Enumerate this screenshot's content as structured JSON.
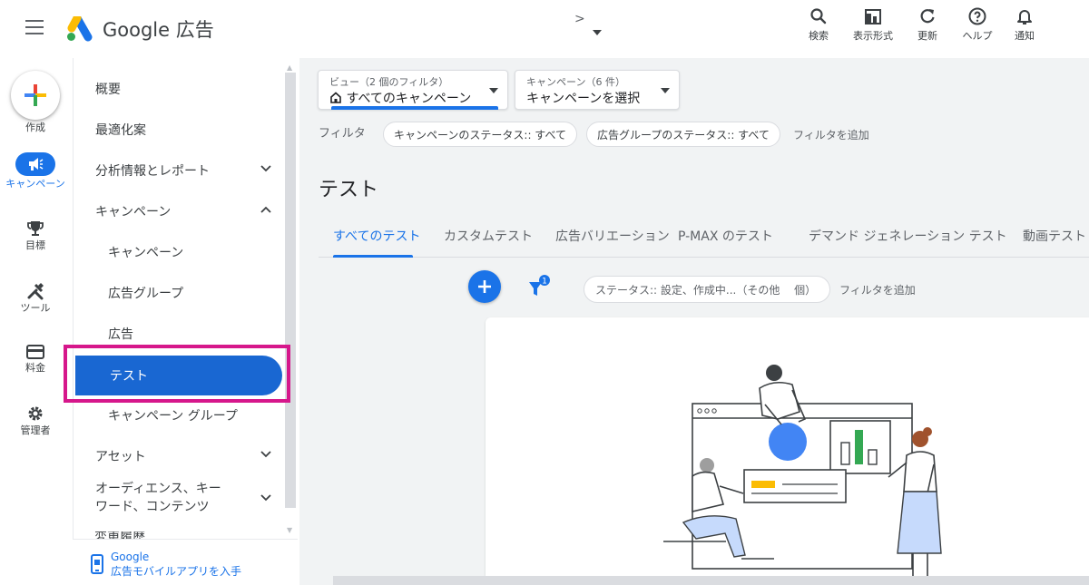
{
  "header": {
    "brand": "Google 広告",
    "breadcrumb_arrow": ">",
    "tools": [
      {
        "icon": "search-icon",
        "label": "検索"
      },
      {
        "icon": "view-format-icon",
        "label": "表示形式"
      },
      {
        "icon": "refresh-icon",
        "label": "更新"
      },
      {
        "icon": "help-icon",
        "label": "ヘルプ"
      },
      {
        "icon": "bell-icon",
        "label": "通知"
      }
    ]
  },
  "rail": {
    "create_label": "作成",
    "items": [
      {
        "icon": "megaphone-icon",
        "label": "キャンペーン",
        "active": true
      },
      {
        "icon": "trophy-icon",
        "label": "目標"
      },
      {
        "icon": "tools-icon",
        "label": "ツール"
      },
      {
        "icon": "credit-card-icon",
        "label": "料金"
      },
      {
        "icon": "gear-icon",
        "label": "管理者"
      }
    ]
  },
  "subnav": {
    "items": [
      {
        "label": "概要"
      },
      {
        "label": "最適化案"
      },
      {
        "label": "分析情報とレポート"
      },
      {
        "label": "キャンペーン"
      },
      {
        "label": "キャンペーン"
      },
      {
        "label": "広告グループ"
      },
      {
        "label": "広告"
      },
      {
        "label": "テスト"
      },
      {
        "label": "キャンペーン グループ"
      },
      {
        "label": "アセット"
      },
      {
        "label": "オーディエンス、キーワード、コンテンツ"
      },
      {
        "label": "変更履歴"
      }
    ],
    "app_promo": {
      "line1": "Google",
      "line2": "広告モバイルアプリを入手"
    }
  },
  "main": {
    "view_picker": {
      "label": "ビュー（2 個のフィルタ）",
      "value": "すべてのキャンペーン"
    },
    "campaign_picker": {
      "label": "キャンペーン（6 件）",
      "value": "キャンペーンを選択"
    },
    "filter_title": "フィルタ",
    "filter_chips": [
      "キャンペーンのステータス:: すべて",
      "広告グループのステータス:: すべて"
    ],
    "add_filter": "フィルタを追加",
    "page_title": "テスト",
    "tabs": [
      "すべてのテスト",
      "カスタムテスト",
      "広告バリエーション",
      "P-MAX のテスト",
      "デマンド ジェネレーション テスト",
      "動画テスト"
    ],
    "filter_count": "1",
    "status_filter": "ステータス:: 設定、作成中...（その他　 個）",
    "add_filter2": "フィルタを追加"
  },
  "colors": {
    "accent": "#1a73e8",
    "highlight": "#d6178b",
    "active_nav": "#1967d2",
    "background": "#f1f3f4"
  }
}
